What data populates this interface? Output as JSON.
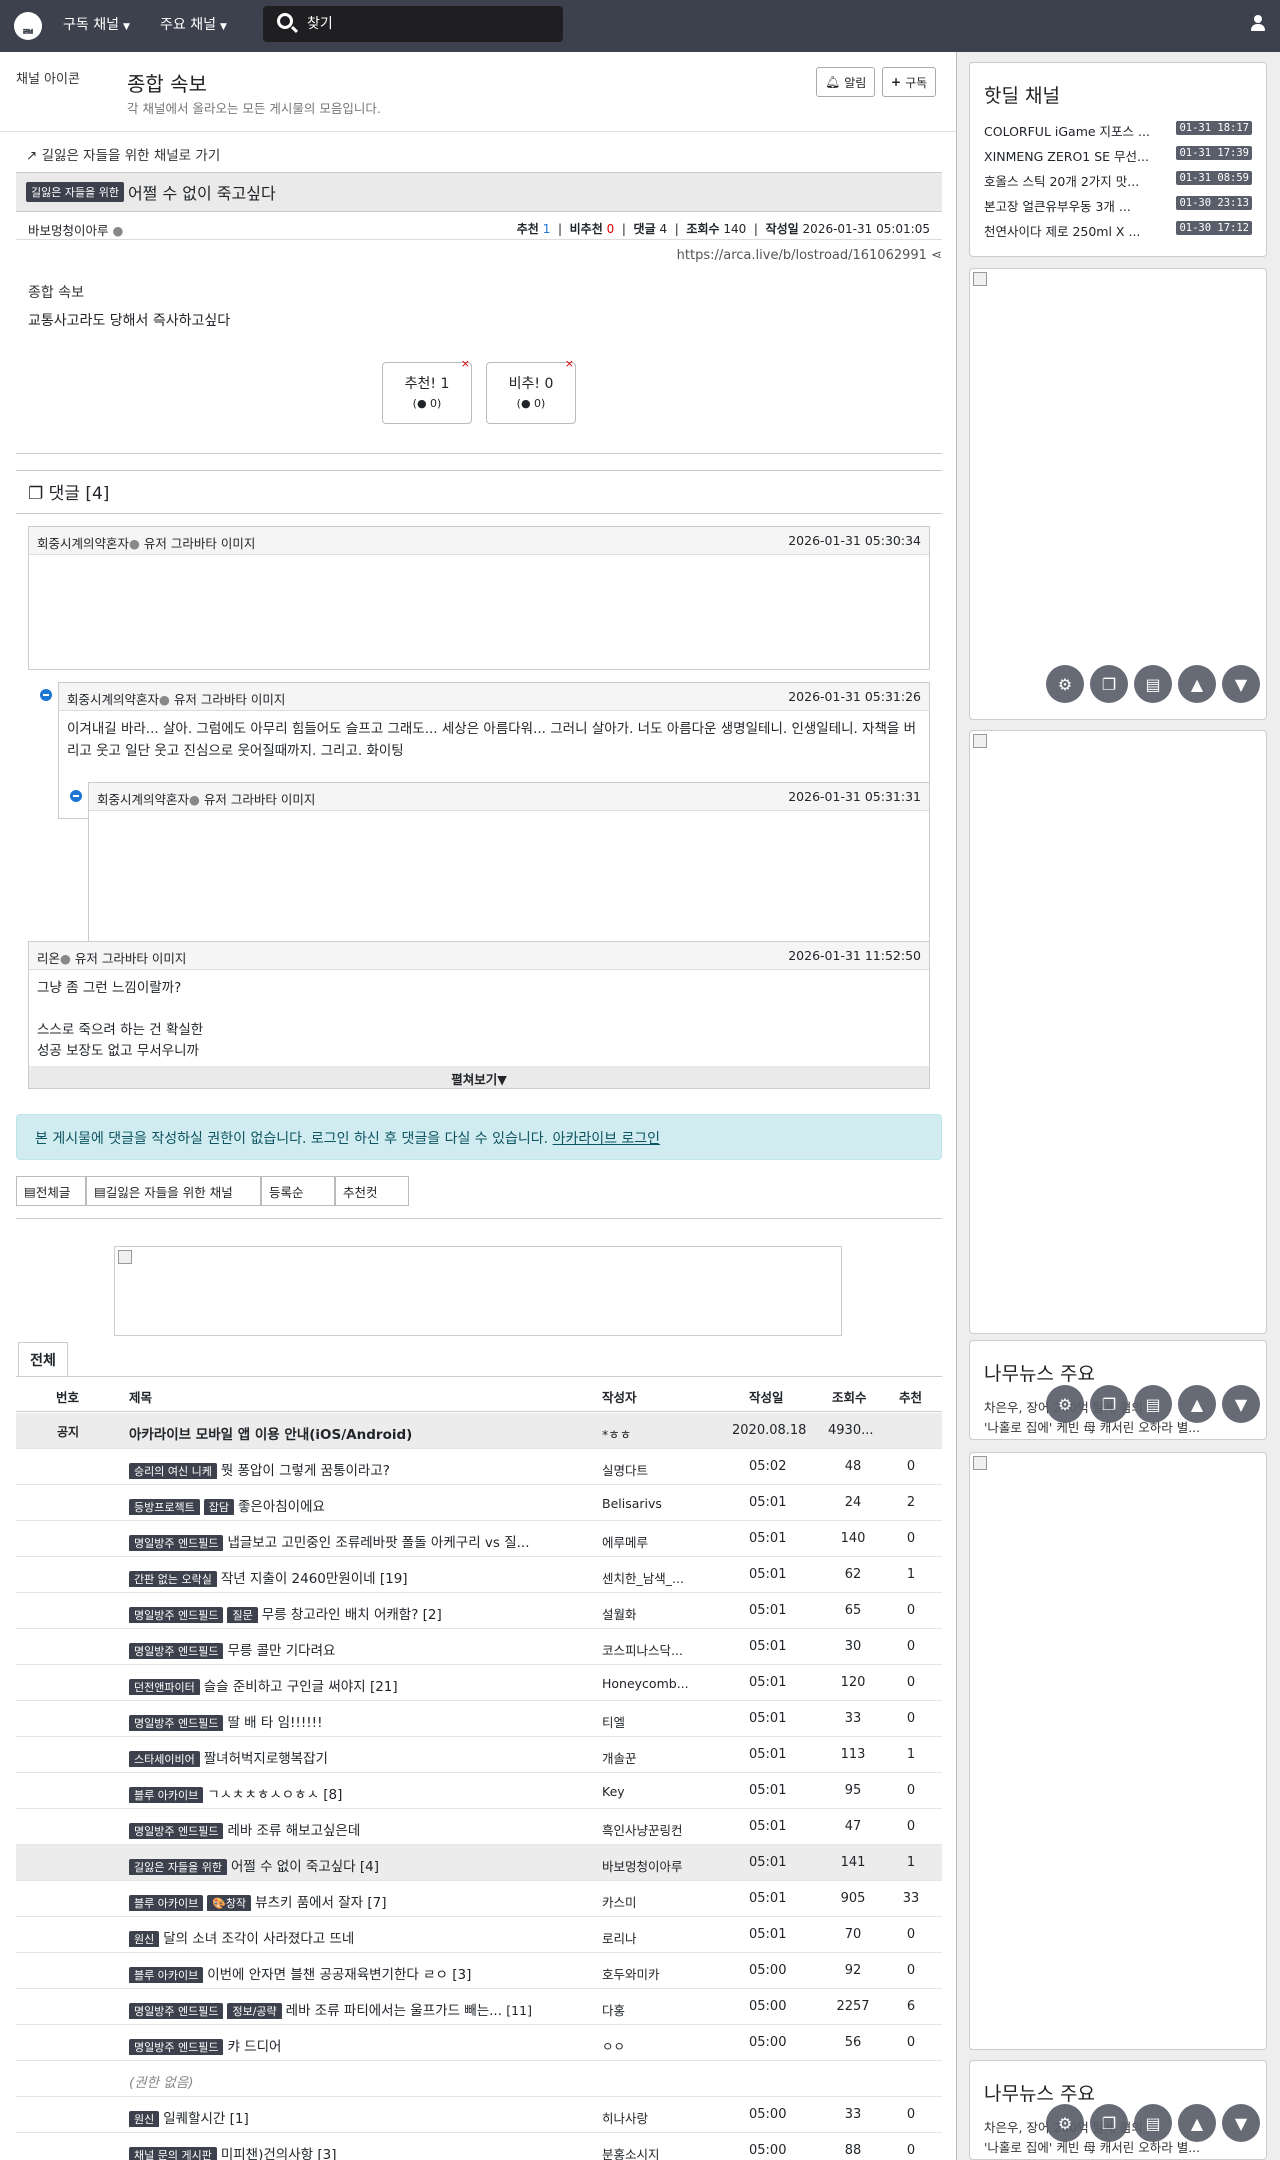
{
  "nav": {
    "logo": "ᆲ",
    "menu1": "구독 채널",
    "menu2": "주요 채널",
    "search_placeholder": "찾기"
  },
  "channel": {
    "icon_alt": "채널 아이콘",
    "title": "종합 속보",
    "desc": "각 채널에서 올라오는 모든 게시물의 모음입니다.",
    "alarm": "알림",
    "subscribe": "구독"
  },
  "post": {
    "back_link": "길잃은 자들을 위한 채널로 가기",
    "category": "길잃은 자들을 위한",
    "title": "어쩔 수 없이 죽고싶다",
    "author": "바보멍청이아루",
    "meta_rec_label": "추천",
    "meta_rec": "1",
    "meta_unrec_label": "비추천",
    "meta_unrec": "0",
    "meta_cm_label": "댓글",
    "meta_cm": "4",
    "meta_view_label": "조회수",
    "meta_view": "140",
    "meta_date_label": "작성일",
    "meta_date": "2026-01-31 05:01:05",
    "url": "https://arca.live/b/lostroad/161062991",
    "img_alt": "종합 속보",
    "body": "교통사고라도 당해서 즉사하고싶다",
    "vote_up": "추천! 1",
    "vote_up_sub": "0",
    "vote_down": "비추! 0",
    "vote_down_sub": "0"
  },
  "comments": {
    "header": "댓글 [4]",
    "avatar_alt": "유저 그라바타 이미지",
    "items": [
      {
        "author": "회중시계의약혼자",
        "time": "2026-01-31 05:30:34",
        "text": ""
      },
      {
        "author": "회중시계의약혼자",
        "time": "2026-01-31 05:31:26",
        "text": "이겨내길 바라... 살아. 그럼에도 아무리 힘들어도 슬프고 그래도... 세상은 아름다워... 그러니 살아가. 너도 아름다운 생명일테니. 인생일테니. 자책을 버리고 웃고 일단 웃고 진심으로 웃어질때까지. 그리고. 화이팅"
      },
      {
        "author": "회중시계의약혼자",
        "time": "2026-01-31 05:31:31",
        "text": ""
      },
      {
        "author": "리온",
        "time": "2026-01-31 11:52:50",
        "line1": "그냥 좀 그런 느낌이랄까?",
        "line2": "스스로 죽으려 하는 건 확실한",
        "line3": "성공 보장도 없고 무서우니까"
      }
    ],
    "expand": "펼쳐보기▼"
  },
  "alert": {
    "text": "본 게시물에 댓글을 작성하실 권한이 없습니다. 로그인 하신 후 댓글을 다실 수 있습니다.",
    "link": "아카라이브 로그인"
  },
  "tabs": {
    "all": "전체글",
    "channel": "길잃은 자들을 위한 채널",
    "order": "등록순",
    "best": "추천컷"
  },
  "list": {
    "tab": "전체",
    "headers": {
      "num": "번호",
      "title": "제목",
      "author": "작성자",
      "date": "작성일",
      "views": "조회수",
      "rec": "추천"
    },
    "notice": {
      "num": "공지",
      "title": "아카라이브 모바일 앱 이용 안내(iOS/Android)",
      "author": "*ㅎㅎ",
      "date": "2020.08.18",
      "views": "4930...",
      "rec": ""
    },
    "rows": [
      {
        "cat": "승리의 여신 니케",
        "cat2": "",
        "title": "뭣 퐁압이 그렇게 꿈통이라고?",
        "cm": "",
        "author": "실명다트",
        "time": "05:02",
        "views": "48",
        "rec": "0"
      },
      {
        "cat": "등방프로젝트",
        "cat2": "잡담",
        "title": "좋은아침이에요",
        "cm": "",
        "author": "Belisarivs",
        "time": "05:01",
        "views": "24",
        "rec": "2"
      },
      {
        "cat": "명일방주 엔드필드",
        "cat2": "",
        "title": "냅글보고 고민중인 조류레바팟 폴돌 아케구리 vs 질...",
        "cm": "",
        "author": "에루메루",
        "time": "05:01",
        "views": "140",
        "rec": "0"
      },
      {
        "cat": "간판 없는 오락실",
        "cat2": "",
        "title": "작년 지출이 2460만원이네 [19]",
        "cm": "",
        "author": "센치한_남색_...",
        "time": "05:01",
        "views": "62",
        "rec": "1"
      },
      {
        "cat": "명일방주 엔드필드",
        "cat2": "질문",
        "title": "무릉 창고라인 배치 어캐함? [2]",
        "cm": "",
        "author": "설월화",
        "time": "05:01",
        "views": "65",
        "rec": "0"
      },
      {
        "cat": "명일방주 엔드필드",
        "cat2": "",
        "title": "무릉 콜만 기다려요",
        "cm": "",
        "author": "코스피나스닥...",
        "time": "05:01",
        "views": "30",
        "rec": "0"
      },
      {
        "cat": "던전앤파이터",
        "cat2": "",
        "title": "슬슬 준비하고 구인글 써야지 [21]",
        "cm": "",
        "author": "Honeycomb...",
        "time": "05:01",
        "views": "120",
        "rec": "0"
      },
      {
        "cat": "명일방주 엔드필드",
        "cat2": "",
        "title": "딸 배 타 임!!!!!!",
        "cm": "",
        "author": "티엘",
        "time": "05:01",
        "views": "33",
        "rec": "0"
      },
      {
        "cat": "스타세이비어",
        "cat2": "",
        "title": "짤녀허벅지로행복잡기",
        "cm": "",
        "author": "개솔꾼",
        "time": "05:01",
        "views": "113",
        "rec": "1"
      },
      {
        "cat": "블루 아카이브",
        "cat2": "",
        "title": "ㄱㅅㅊㅊㅎㅅㅇㅎㅅ [8]",
        "cm": "",
        "author": "Key",
        "time": "05:01",
        "views": "95",
        "rec": "0"
      },
      {
        "cat": "명일방주 엔드필드",
        "cat2": "",
        "title": "레바 조류 해보고싶은데",
        "cm": "",
        "author": "흑인사냥꾼링컨",
        "time": "05:01",
        "views": "47",
        "rec": "0"
      },
      {
        "cat": "길잃은 자들을 위한",
        "cat2": "",
        "title": "어쩔 수 없이 죽고싶다 [4]",
        "cm": "",
        "author": "바보멍청이아루",
        "time": "05:01",
        "views": "141",
        "rec": "1"
      },
      {
        "cat": "블루 아카이브",
        "cat2": "🎨창작",
        "title": "뷰츠키 품에서 잘자 [7]",
        "cm": "",
        "author": "카스미",
        "time": "05:01",
        "views": "905",
        "rec": "33"
      },
      {
        "cat": "원신",
        "cat2": "",
        "title": "달의 소녀 조각이 사라졌다고 뜨네",
        "cm": "",
        "author": "로리나",
        "time": "05:01",
        "views": "70",
        "rec": "0"
      },
      {
        "cat": "블루 아카이브",
        "cat2": "",
        "title": "이번에 안자면 블챈 공공재육변기한다 ㄹㅇ [3]",
        "cm": "",
        "author": "호두와미카",
        "time": "05:00",
        "views": "92",
        "rec": "0"
      },
      {
        "cat": "명일방주 엔드필드",
        "cat2": "정보/공략",
        "title": "레바 조류 파티에서는 울프가드 빼는...",
        "cm": "[11]",
        "author": "다홍",
        "time": "05:00",
        "views": "2257",
        "rec": "6"
      },
      {
        "cat": "명일방주 엔드필드",
        "cat2": "",
        "title": "캬 드디어",
        "cm": "",
        "author": "ㅇㅇ",
        "time": "05:00",
        "views": "56",
        "rec": "0"
      },
      {
        "cat": "",
        "cat2": "",
        "title": "(권한 없음)",
        "cm": "",
        "author": "",
        "time": "",
        "views": "",
        "rec": ""
      },
      {
        "cat": "원신",
        "cat2": "",
        "title": "일퀘할시간 [1]",
        "cm": "",
        "author": "히나사랑",
        "time": "05:00",
        "views": "33",
        "rec": "0"
      },
      {
        "cat": "채널 문의 게시판",
        "cat2": "",
        "title": "미피챈)건의사항 [3]",
        "cm": "",
        "author": "분홍소시지",
        "time": "05:00",
        "views": "88",
        "rec": "0"
      }
    ]
  },
  "sidebar": {
    "hotdeal_title": "핫딜 채널",
    "deals": [
      {
        "title": "COLORFUL iGame 지포스 ...",
        "date": "01-31 18:17"
      },
      {
        "title": "XINMENG ZERO1 SE 무선...",
        "date": "01-31 17:39"
      },
      {
        "title": "호올스 스틱 20개 2가지 맛...",
        "date": "01-31 08:59"
      },
      {
        "title": "본고장 얼큰유부우동 3개 ...",
        "date": "01-30 23:13"
      },
      {
        "title": "천연사이다 제로 250ml X ...",
        "date": "01-30 17:12"
      }
    ],
    "news_title": "나무뉴스 주요",
    "news_line1": "차은우, 장어 200억 탈세 혐의 회",
    "news_line2": "'나홀로 집에' 케빈 母 캐서린 오하라 별...",
    "news_title2": "나무뉴스 주요",
    "news2_line1": "차은우, 장어 200억 탈세 혐의 회",
    "news2_line2": "'나홀로 집에' 케빈 母 캐서린 오하라 별..."
  }
}
